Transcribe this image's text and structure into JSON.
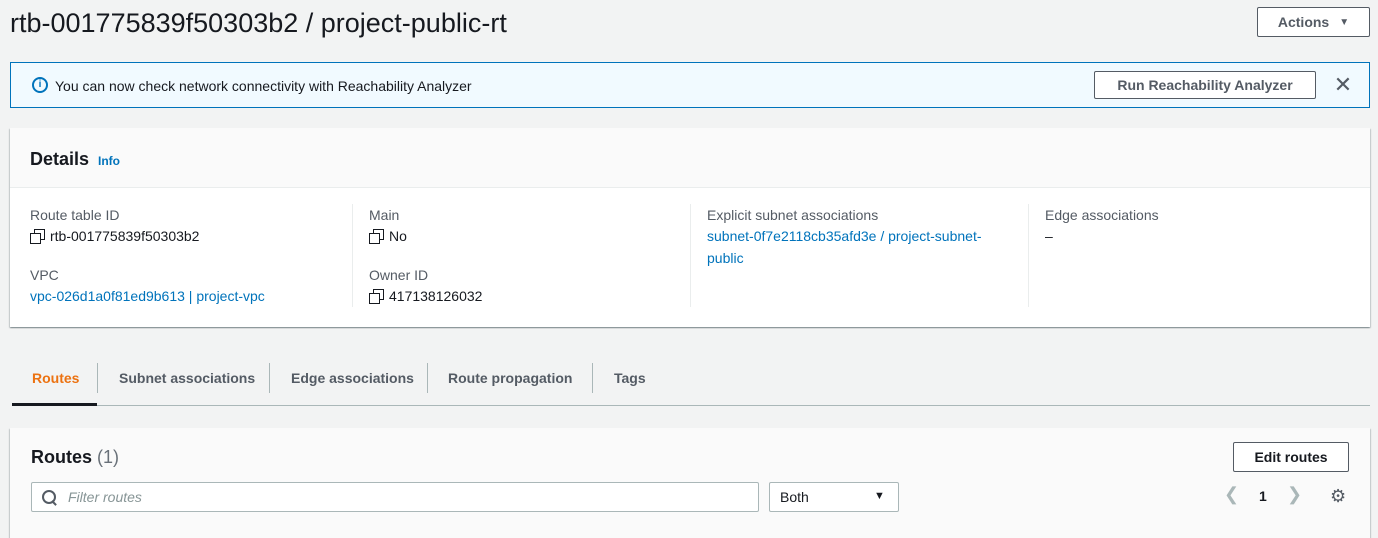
{
  "page": {
    "title": "rtb-001775839f50303b2 / project-public-rt",
    "actions_label": "Actions"
  },
  "alert": {
    "text": "You can now check network connectivity with Reachability Analyzer",
    "button_label": "Run Reachability Analyzer"
  },
  "details": {
    "title": "Details",
    "info_label": "Info",
    "route_table_id_label": "Route table ID",
    "route_table_id": "rtb-001775839f50303b2",
    "vpc_label": "VPC",
    "vpc_value": "vpc-026d1a0f81ed9b613 | project-vpc",
    "main_label": "Main",
    "main_value": "No",
    "owner_id_label": "Owner ID",
    "owner_id": "417138126032",
    "explicit_label": "Explicit subnet associations",
    "explicit_value": "subnet-0f7e2118cb35afd3e / project-subnet-public",
    "edge_label": "Edge associations",
    "edge_value": "–"
  },
  "tabs": [
    {
      "label": "Routes",
      "active": true
    },
    {
      "label": "Subnet associations",
      "active": false
    },
    {
      "label": "Edge associations",
      "active": false
    },
    {
      "label": "Route propagation",
      "active": false
    },
    {
      "label": "Tags",
      "active": false
    }
  ],
  "routes": {
    "title": "Routes",
    "count": "(1)",
    "edit_label": "Edit routes",
    "filter_placeholder": "Filter routes",
    "select_value": "Both",
    "page_number": "1"
  },
  "colors": {
    "accent": "#ec7211",
    "link": "#0073bb",
    "alert_bg": "#f1faff"
  }
}
